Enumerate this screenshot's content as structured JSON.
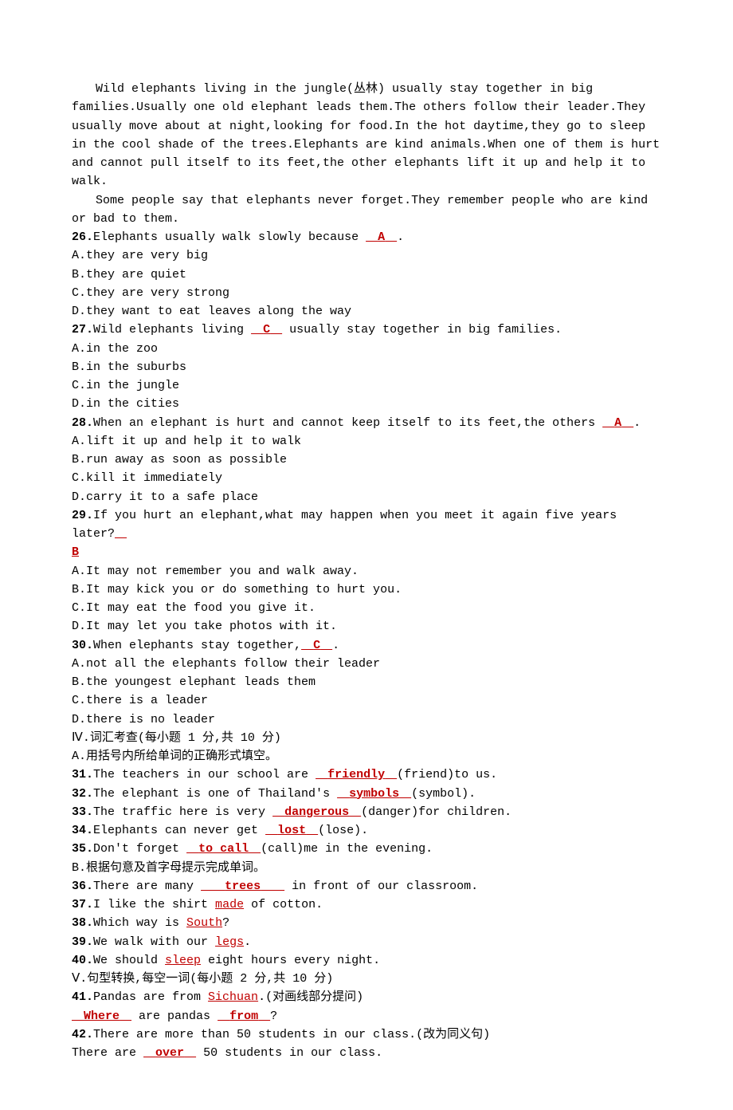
{
  "passage": {
    "p1": "Wild elephants living in the jungle(丛林) usually stay together in big families.Usually one old elephant leads them.The others follow their leader.They usually move about at night,looking for food.In the hot daytime,they go to sleep in the cool shade of the trees.Elephants are kind animals.When one of them is hurt and cannot pull itself to its feet,the other elephants lift it up and help it to walk.",
    "p2": "Some people say that elephants never forget.They remember people who are kind or bad to them."
  },
  "q26": {
    "num": "26.",
    "stem": "Elephants usually walk slowly because ",
    "ans": "A",
    "tail": ".",
    "a": "A.they are very big",
    "b": "B.they are quiet",
    "c": "C.they are very strong",
    "d": "D.they want to eat leaves along the way"
  },
  "q27": {
    "num": "27.",
    "stem": "Wild elephants living ",
    "ans": "C",
    "tail": " usually stay together in big families.",
    "a": "A.in the zoo",
    "b": "B.in the suburbs",
    "c": "C.in the jungle",
    "d": "D.in the cities"
  },
  "q28": {
    "num": "28.",
    "stem": "When an elephant is hurt and cannot keep itself to its feet,the others ",
    "ans": "A",
    "tail": ".",
    "a": "A.lift it up and help it to walk",
    "b": "B.run away as soon as possible",
    "c": "C.kill it immediately",
    "d": "D.carry it to a safe place"
  },
  "q29": {
    "num": "29.",
    "stem": "If you hurt an elephant,what may happen when you meet it again five years later?",
    "ans": "B   ",
    "a": "A.It may not remember you and walk away.",
    "b": "B.It may kick you or do something to hurt you.",
    "c": "C.It may eat the food you give it.",
    "d": "D.It may let you take photos with it."
  },
  "q30": {
    "num": "30.",
    "stem": "When elephants stay together,",
    "ans": "C",
    "tail": ".",
    "a": "A.not all the elephants follow their leader",
    "b": "B.the youngest elephant leads them",
    "c": "C.there is a leader",
    "d": "D.there is no leader"
  },
  "sec4": {
    "title": "Ⅳ.词汇考查(每小题 1 分,共 10 分)",
    "subA": "A.用括号内所给单词的正确形式填空。"
  },
  "q31": {
    "num": "31.",
    "pre": "The teachers in our school are ",
    "ans": "friendly",
    "post": "(friend)to us."
  },
  "q32": {
    "num": "32.",
    "pre": "The elephant is one of Thailand's ",
    "ans": "symbols",
    "post": "(symbol)."
  },
  "q33": {
    "num": "33.",
    "pre": "The traffic here is very ",
    "ans": "dangerous",
    "post": "(danger)for children."
  },
  "q34": {
    "num": "34.",
    "pre": "Elephants can never get ",
    "ans": "lost",
    "post": "(lose)."
  },
  "q35": {
    "num": "35.",
    "pre": "Don't forget ",
    "ans": "to call",
    "post": "(call)me in the evening."
  },
  "subB": "B.根据句意及首字母提示完成单词。",
  "q36": {
    "num": "36.",
    "pre": "There are many ",
    "ans": "trees",
    "post": " in front of our classroom."
  },
  "q37": {
    "num": "37.",
    "pre": "I like the shirt ",
    "first": "m",
    "ans": "ade",
    "post": " of cotton."
  },
  "q38": {
    "num": "38.",
    "pre": "Which way is ",
    "first": "S",
    "ans": "outh",
    "post": "?"
  },
  "q39": {
    "num": "39.",
    "pre": "We walk with our ",
    "first": "l",
    "ans": "egs",
    "post": "."
  },
  "q40": {
    "num": "40.",
    "pre": "We should ",
    "first": "s",
    "ans": "leep",
    "post": " eight hours every night."
  },
  "sec5": {
    "title": "Ⅴ.句型转换,每空一词(每小题 2 分,共 10 分)"
  },
  "q41": {
    "num": "41.",
    "pre": "Pandas are from ",
    "target": "Sichuan",
    "post": ".(对画线部分提问)",
    "ans1": "Where",
    "mid": " are pandas ",
    "ans2": "from",
    "tail": "?"
  },
  "q42": {
    "num": "42.",
    "stem": "There are more than 50 students in our class.(改为同义句)",
    "pre": "There are ",
    "ans": "over",
    "post": " 50 students in our class."
  }
}
